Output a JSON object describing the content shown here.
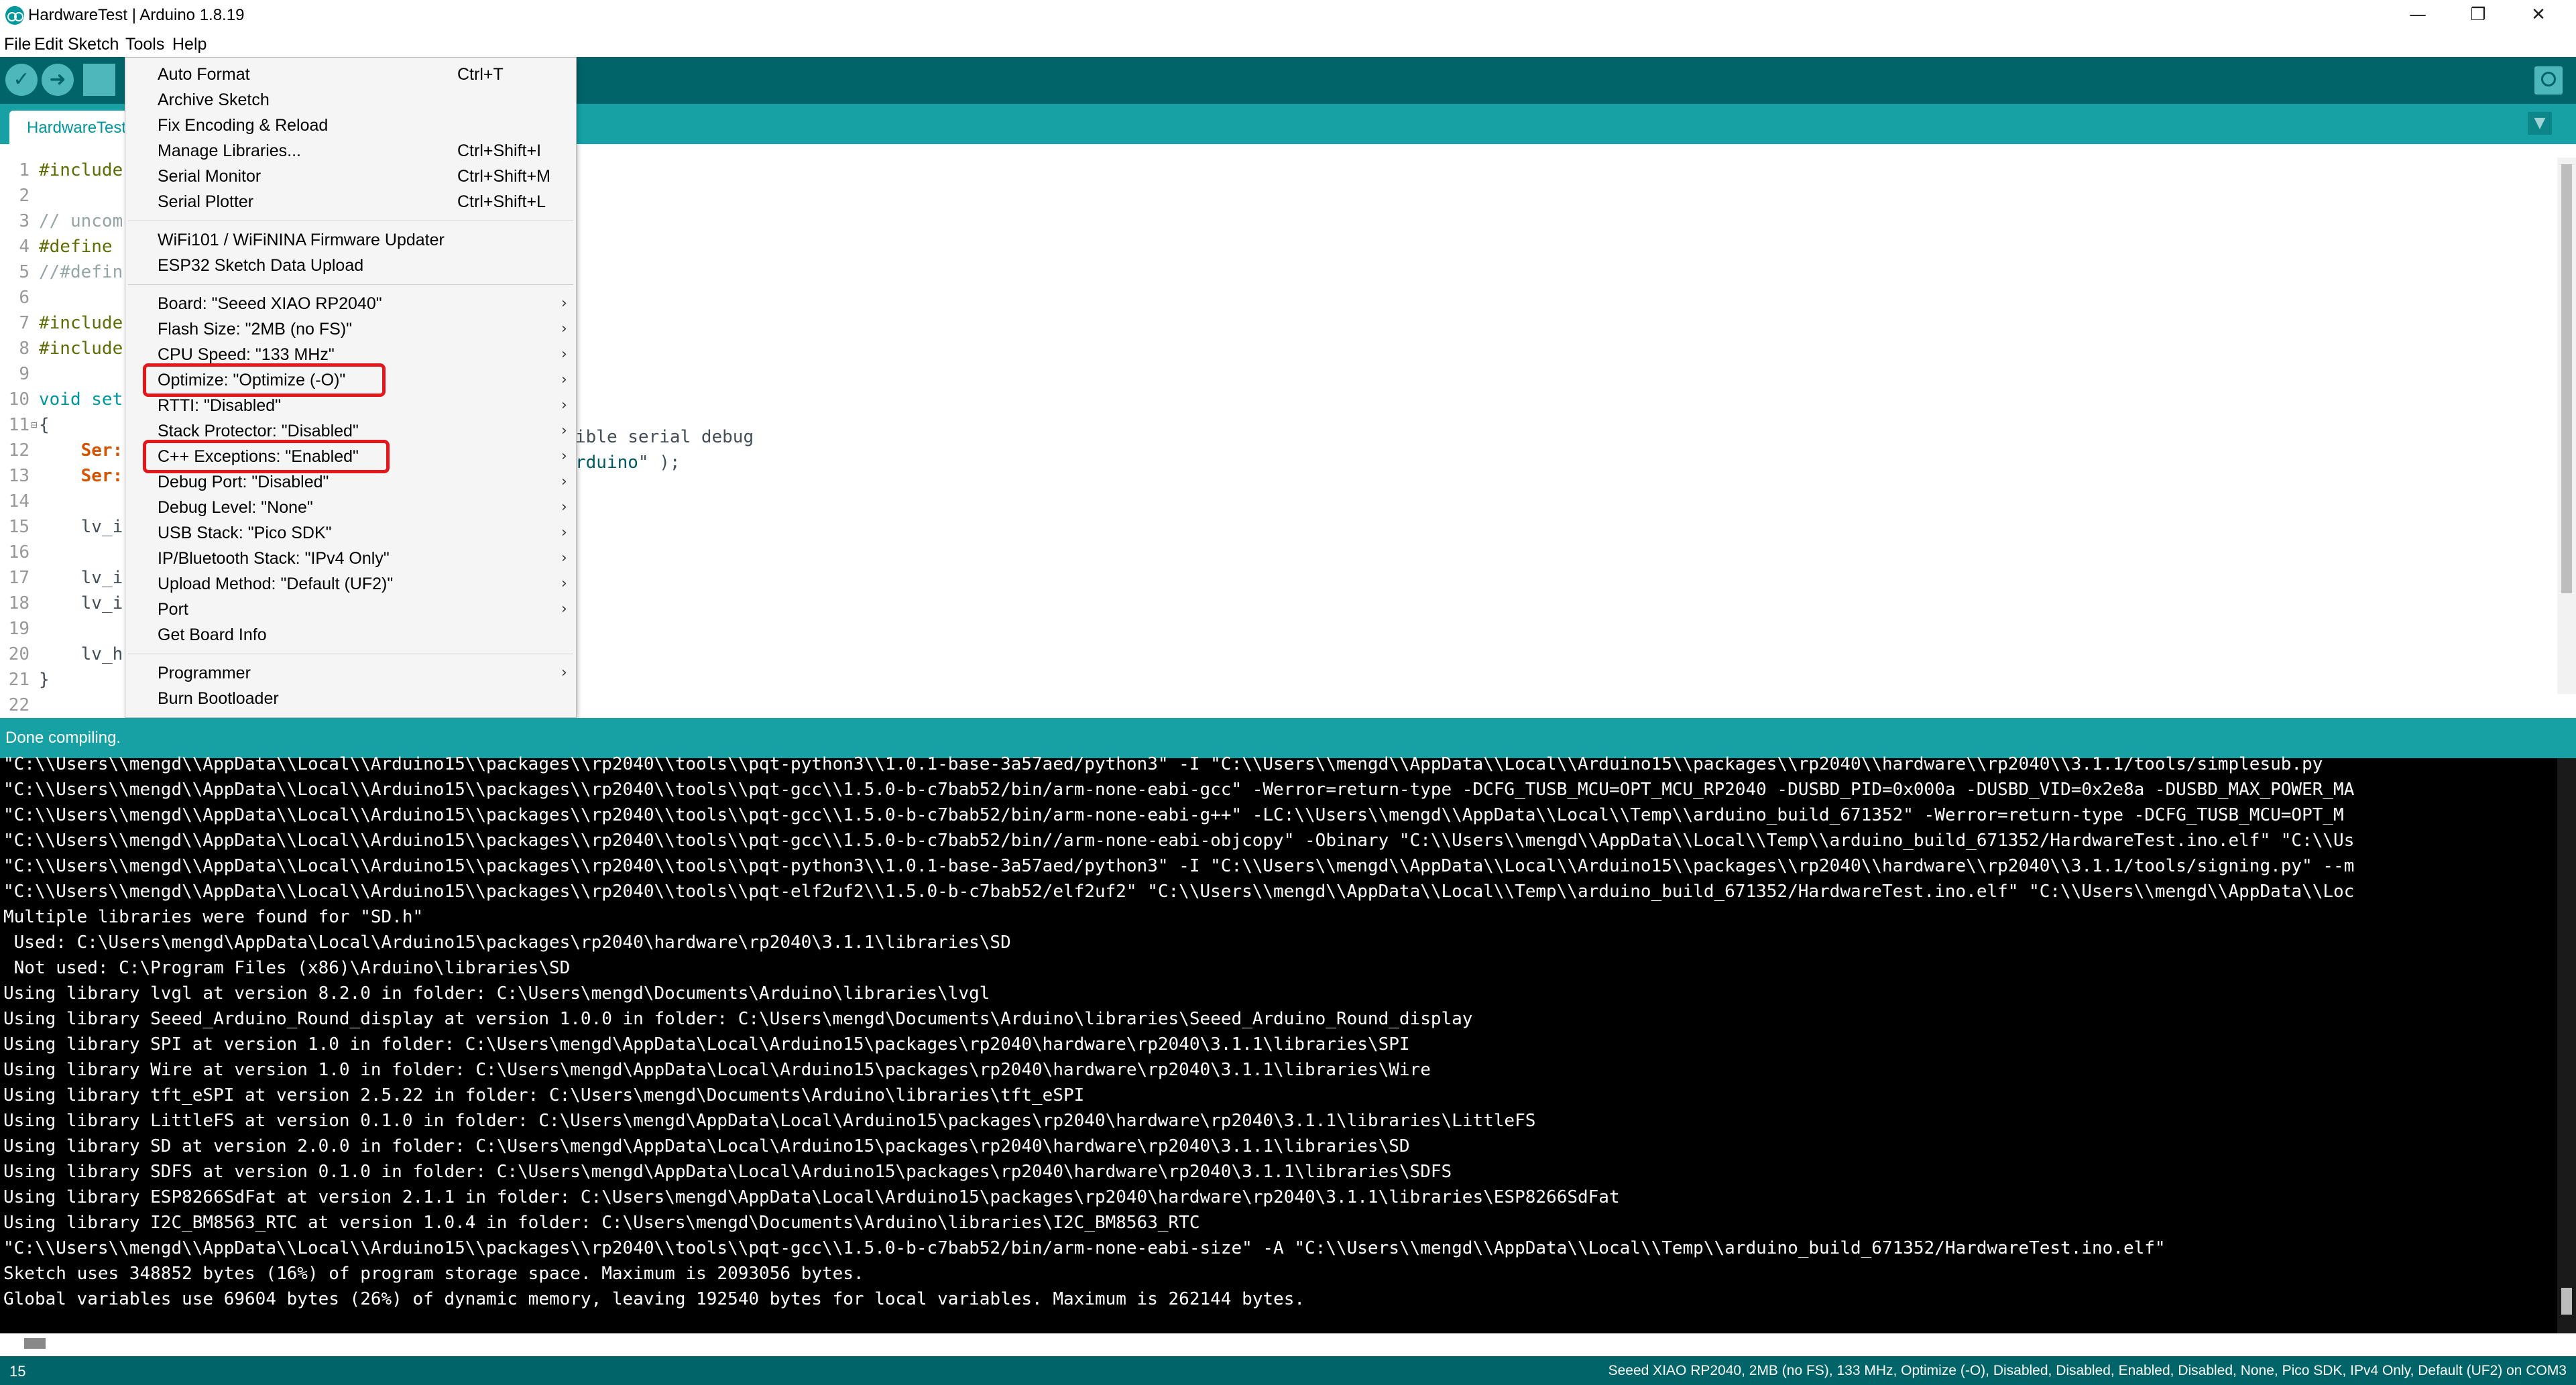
{
  "window": {
    "title": "HardwareTest | Arduino 1.8.19",
    "minimize": "—",
    "maximize": "❐",
    "close": "✕"
  },
  "menubar": [
    "File",
    "Edit",
    "Sketch",
    "Tools",
    "Help"
  ],
  "tab": {
    "label": "HardwareTest"
  },
  "tab_menu_icon": "▼",
  "editor": {
    "lines": [
      {
        "n": "1",
        "text": "#include"
      },
      {
        "n": "2",
        "text": ""
      },
      {
        "n": "3",
        "text": "// uncom"
      },
      {
        "n": "4",
        "text": "#define"
      },
      {
        "n": "5",
        "text": "//#defin"
      },
      {
        "n": "6",
        "text": ""
      },
      {
        "n": "7",
        "text": "#include"
      },
      {
        "n": "8",
        "text": "#include"
      },
      {
        "n": "9",
        "text": ""
      },
      {
        "n": "10",
        "text": "void set"
      },
      {
        "n": "11",
        "text": "{"
      },
      {
        "n": "12",
        "text": "    Ser:"
      },
      {
        "n": "13",
        "text": "    Ser:"
      },
      {
        "n": "14",
        "text": ""
      },
      {
        "n": "15",
        "text": "    lv_i"
      },
      {
        "n": "16",
        "text": ""
      },
      {
        "n": "17",
        "text": "    lv_i"
      },
      {
        "n": "18",
        "text": "    lv_i"
      },
      {
        "n": "19",
        "text": ""
      },
      {
        "n": "20",
        "text": "    lv_h"
      },
      {
        "n": "21",
        "text": "}"
      },
      {
        "n": "22",
        "text": ""
      }
    ],
    "fold_marker": "⊟",
    "tail_12": "ible serial debug",
    "tail_13a": "rduino",
    "tail_13b": "\" );"
  },
  "tools_menu": {
    "items": [
      {
        "label": "Auto Format",
        "shortcut": "Ctrl+T"
      },
      {
        "label": "Archive Sketch",
        "shortcut": ""
      },
      {
        "label": "Fix Encoding & Reload",
        "shortcut": ""
      },
      {
        "label": "Manage Libraries...",
        "shortcut": "Ctrl+Shift+I"
      },
      {
        "label": "Serial Monitor",
        "shortcut": "Ctrl+Shift+M"
      },
      {
        "label": "Serial Plotter",
        "shortcut": "Ctrl+Shift+L"
      },
      {
        "label": "WiFi101 / WiFiNINA Firmware Updater",
        "shortcut": ""
      },
      {
        "label": "ESP32 Sketch Data Upload",
        "shortcut": ""
      },
      {
        "label": "Board: \"Seeed XIAO RP2040\"",
        "submenu": true
      },
      {
        "label": "Flash Size: \"2MB (no FS)\"",
        "submenu": true
      },
      {
        "label": "CPU Speed: \"133 MHz\"",
        "submenu": true
      },
      {
        "label": "Optimize: \"Optimize (-O)\"",
        "submenu": true,
        "highlighted": true
      },
      {
        "label": "RTTI: \"Disabled\"",
        "submenu": true
      },
      {
        "label": "Stack Protector: \"Disabled\"",
        "submenu": true
      },
      {
        "label": "C++ Exceptions: \"Enabled\"",
        "submenu": true,
        "highlighted": true
      },
      {
        "label": "Debug Port: \"Disabled\"",
        "submenu": true
      },
      {
        "label": "Debug Level: \"None\"",
        "submenu": true
      },
      {
        "label": "USB Stack: \"Pico SDK\"",
        "submenu": true
      },
      {
        "label": "IP/Bluetooth Stack: \"IPv4 Only\"",
        "submenu": true
      },
      {
        "label": "Upload Method: \"Default (UF2)\"",
        "submenu": true
      },
      {
        "label": "Port",
        "submenu": true
      },
      {
        "label": "Get Board Info",
        "submenu": false
      },
      {
        "label": "Programmer",
        "submenu": true
      },
      {
        "label": "Burn Bootloader",
        "submenu": false
      }
    ],
    "submenu_arrow": "›",
    "highlight_color": "#e4171d"
  },
  "status": {
    "text": "Done compiling."
  },
  "console": {
    "lines": [
      "\"C:\\\\Users\\\\mengd\\\\AppData\\\\Local\\\\Arduino15\\\\packages\\\\rp2040\\\\tools\\\\pqt-python3\\\\1.0.1-base-3a57aed/python3\" -I \"C:\\\\Users\\\\mengd\\\\AppData\\\\Local\\\\Arduino15\\\\packages\\\\rp2040\\\\hardware\\\\rp2040\\\\3.1.1/tools/simplesub.py",
      "\"C:\\\\Users\\\\mengd\\\\AppData\\\\Local\\\\Arduino15\\\\packages\\\\rp2040\\\\tools\\\\pqt-gcc\\\\1.5.0-b-c7bab52/bin/arm-none-eabi-gcc\" -Werror=return-type -DCFG_TUSB_MCU=OPT_MCU_RP2040 -DUSBD_PID=0x000a -DUSBD_VID=0x2e8a -DUSBD_MAX_POWER_MA",
      "\"C:\\\\Users\\\\mengd\\\\AppData\\\\Local\\\\Arduino15\\\\packages\\\\rp2040\\\\tools\\\\pqt-gcc\\\\1.5.0-b-c7bab52/bin/arm-none-eabi-g++\" -LC:\\\\Users\\\\mengd\\\\AppData\\\\Local\\\\Temp\\\\arduino_build_671352\" -Werror=return-type -DCFG_TUSB_MCU=OPT_M",
      "\"C:\\\\Users\\\\mengd\\\\AppData\\\\Local\\\\Arduino15\\\\packages\\\\rp2040\\\\tools\\\\pqt-gcc\\\\1.5.0-b-c7bab52/bin//arm-none-eabi-objcopy\" -Obinary \"C:\\\\Users\\\\mengd\\\\AppData\\\\Local\\\\Temp\\\\arduino_build_671352/HardwareTest.ino.elf\" \"C:\\\\Us",
      "\"C:\\\\Users\\\\mengd\\\\AppData\\\\Local\\\\Arduino15\\\\packages\\\\rp2040\\\\tools\\\\pqt-python3\\\\1.0.1-base-3a57aed/python3\" -I \"C:\\\\Users\\\\mengd\\\\AppData\\\\Local\\\\Arduino15\\\\packages\\\\rp2040\\\\hardware\\\\rp2040\\\\3.1.1/tools/signing.py\" --m",
      "\"C:\\\\Users\\\\mengd\\\\AppData\\\\Local\\\\Arduino15\\\\packages\\\\rp2040\\\\tools\\\\pqt-elf2uf2\\\\1.5.0-b-c7bab52/elf2uf2\" \"C:\\\\Users\\\\mengd\\\\AppData\\\\Local\\\\Temp\\\\arduino_build_671352/HardwareTest.ino.elf\" \"C:\\\\Users\\\\mengd\\\\AppData\\\\Loc",
      "Multiple libraries were found for \"SD.h\"",
      " Used: C:\\Users\\mengd\\AppData\\Local\\Arduino15\\packages\\rp2040\\hardware\\rp2040\\3.1.1\\libraries\\SD",
      " Not used: C:\\Program Files (x86)\\Arduino\\libraries\\SD",
      "Using library lvgl at version 8.2.0 in folder: C:\\Users\\mengd\\Documents\\Arduino\\libraries\\lvgl",
      "Using library Seeed_Arduino_Round_display at version 1.0.0 in folder: C:\\Users\\mengd\\Documents\\Arduino\\libraries\\Seeed_Arduino_Round_display",
      "Using library SPI at version 1.0 in folder: C:\\Users\\mengd\\AppData\\Local\\Arduino15\\packages\\rp2040\\hardware\\rp2040\\3.1.1\\libraries\\SPI",
      "Using library Wire at version 1.0 in folder: C:\\Users\\mengd\\AppData\\Local\\Arduino15\\packages\\rp2040\\hardware\\rp2040\\3.1.1\\libraries\\Wire",
      "Using library tft_eSPI at version 2.5.22 in folder: C:\\Users\\mengd\\Documents\\Arduino\\libraries\\tft_eSPI",
      "Using library LittleFS at version 0.1.0 in folder: C:\\Users\\mengd\\AppData\\Local\\Arduino15\\packages\\rp2040\\hardware\\rp2040\\3.1.1\\libraries\\LittleFS",
      "Using library SD at version 2.0.0 in folder: C:\\Users\\mengd\\AppData\\Local\\Arduino15\\packages\\rp2040\\hardware\\rp2040\\3.1.1\\libraries\\SD",
      "Using library SDFS at version 0.1.0 in folder: C:\\Users\\mengd\\AppData\\Local\\Arduino15\\packages\\rp2040\\hardware\\rp2040\\3.1.1\\libraries\\SDFS",
      "Using library ESP8266SdFat at version 2.1.1 in folder: C:\\Users\\mengd\\AppData\\Local\\Arduino15\\packages\\rp2040\\hardware\\rp2040\\3.1.1\\libraries\\ESP8266SdFat",
      "Using library I2C_BM8563_RTC at version 1.0.4 in folder: C:\\Users\\mengd\\Documents\\Arduino\\libraries\\I2C_BM8563_RTC",
      "\"C:\\\\Users\\\\mengd\\\\AppData\\\\Local\\\\Arduino15\\\\packages\\\\rp2040\\\\tools\\\\pqt-gcc\\\\1.5.0-b-c7bab52/bin/arm-none-eabi-size\" -A \"C:\\\\Users\\\\mengd\\\\AppData\\\\Local\\\\Temp\\\\arduino_build_671352/HardwareTest.ino.elf\"",
      "Sketch uses 348852 bytes (16%) of program storage space. Maximum is 2093056 bytes.",
      "Global variables use 69604 bytes (26%) of dynamic memory, leaving 192540 bytes for local variables. Maximum is 262144 bytes."
    ]
  },
  "bottom": {
    "line_number": "15",
    "board_config": "Seeed XIAO RP2040, 2MB (no FS), 133 MHz, Optimize (-O), Disabled, Disabled, Enabled, Disabled, None, Pico SDK, IPv4 Only, Default (UF2) on COM3"
  },
  "toolbar": {
    "verify_icon": "✓",
    "upload_icon": "➜"
  }
}
